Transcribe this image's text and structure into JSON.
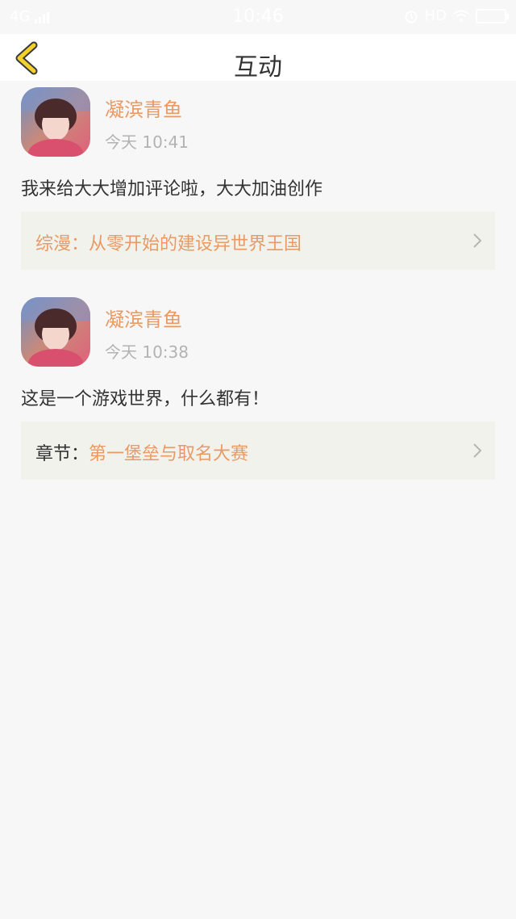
{
  "status_bar": {
    "network": "4G",
    "time": "10:46",
    "hd": "HD"
  },
  "header": {
    "title": "互动"
  },
  "messages": [
    {
      "username": "凝滨青鱼",
      "time": "今天 10:41",
      "text": "我来给大大增加评论啦，大大加油创作",
      "link_prefix": "综漫：",
      "link_title": "从零开始的建设异世界王国"
    },
    {
      "username": "凝滨青鱼",
      "time": "今天 10:38",
      "text": "这是一个游戏世界，什么都有！",
      "link_prefix": "章节：",
      "link_title": "第一堡垒与取名大赛"
    }
  ],
  "colors": {
    "accent": "#e89a66",
    "back_arrow": "#f3d12a",
    "background": "#f7f7f7",
    "card": "#f2f2ec"
  },
  "icons": [
    "back-arrow-icon",
    "signal-icon",
    "alarm-icon",
    "wifi-icon",
    "battery-icon",
    "chevron-right-icon"
  ]
}
